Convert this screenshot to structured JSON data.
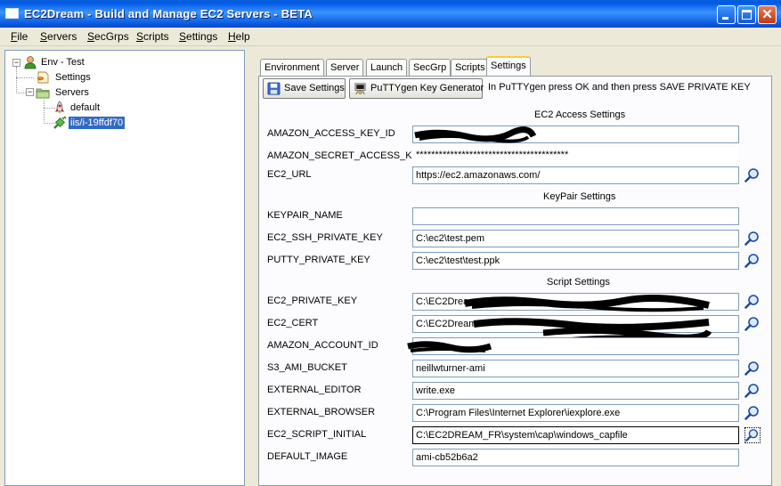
{
  "window": {
    "title": "EC2Dream - Build and Manage EC2 Servers - BETA"
  },
  "menu": [
    "File",
    "Servers",
    "SecGrps",
    "Scripts",
    "Settings",
    "Help"
  ],
  "tree": {
    "root": "Env - Test",
    "settings": "Settings",
    "servers": "Servers",
    "server_default": "default",
    "server_selected": "iis/i-19ffdf70"
  },
  "tabs": [
    "Environment",
    "Server",
    "Launch",
    "SecGrp",
    "Scripts",
    "Settings"
  ],
  "active_tab": "Settings",
  "toolbar": {
    "save_label": "Save Settings",
    "puttygen_label": "PuTTYgen Key Generator",
    "hint": "In PuTTYgen press OK and then press SAVE PRIVATE KEY"
  },
  "sections": {
    "ec2_access": "EC2 Access Settings",
    "keypair": "KeyPair Settings",
    "script": "Script Settings"
  },
  "fields": {
    "amazon_access_key_id": {
      "label": "AMAZON_ACCESS_KEY_ID",
      "value": ""
    },
    "amazon_secret_access_key": {
      "label": "AMAZON_SECRET_ACCESS_KEY",
      "value": "****************************************"
    },
    "ec2_url": {
      "label": "EC2_URL",
      "value": "https://ec2.amazonaws.com/"
    },
    "keypair_name": {
      "label": "KEYPAIR_NAME",
      "value": ""
    },
    "ec2_ssh_private_key": {
      "label": "EC2_SSH_PRIVATE_KEY",
      "value": "C:\\ec2\\test.pem"
    },
    "putty_private_key": {
      "label": "PUTTY_PRIVATE_KEY",
      "value": "C:\\ec2\\test\\test.ppk"
    },
    "ec2_private_key": {
      "label": "EC2_PRIVATE_KEY",
      "value": "C:\\EC2Drea"
    },
    "ec2_cert": {
      "label": "EC2_CERT",
      "value": "C:\\EC2Dream"
    },
    "amazon_account_id": {
      "label": "AMAZON_ACCOUNT_ID",
      "value": ""
    },
    "s3_ami_bucket": {
      "label": "S3_AMI_BUCKET",
      "value": "neillwturner-ami"
    },
    "external_editor": {
      "label": "EXTERNAL_EDITOR",
      "value": "write.exe"
    },
    "external_browser": {
      "label": "EXTERNAL_BROWSER",
      "value": "C:\\Program Files\\Internet Explorer\\iexplore.exe"
    },
    "ec2_script_initial": {
      "label": "EC2_SCRIPT_INITIAL",
      "value": "C:\\EC2DREAM_FR\\system\\cap\\windows_capfile"
    },
    "default_image": {
      "label": "DEFAULT_IMAGE",
      "value": "ami-cb52b6a2"
    }
  }
}
